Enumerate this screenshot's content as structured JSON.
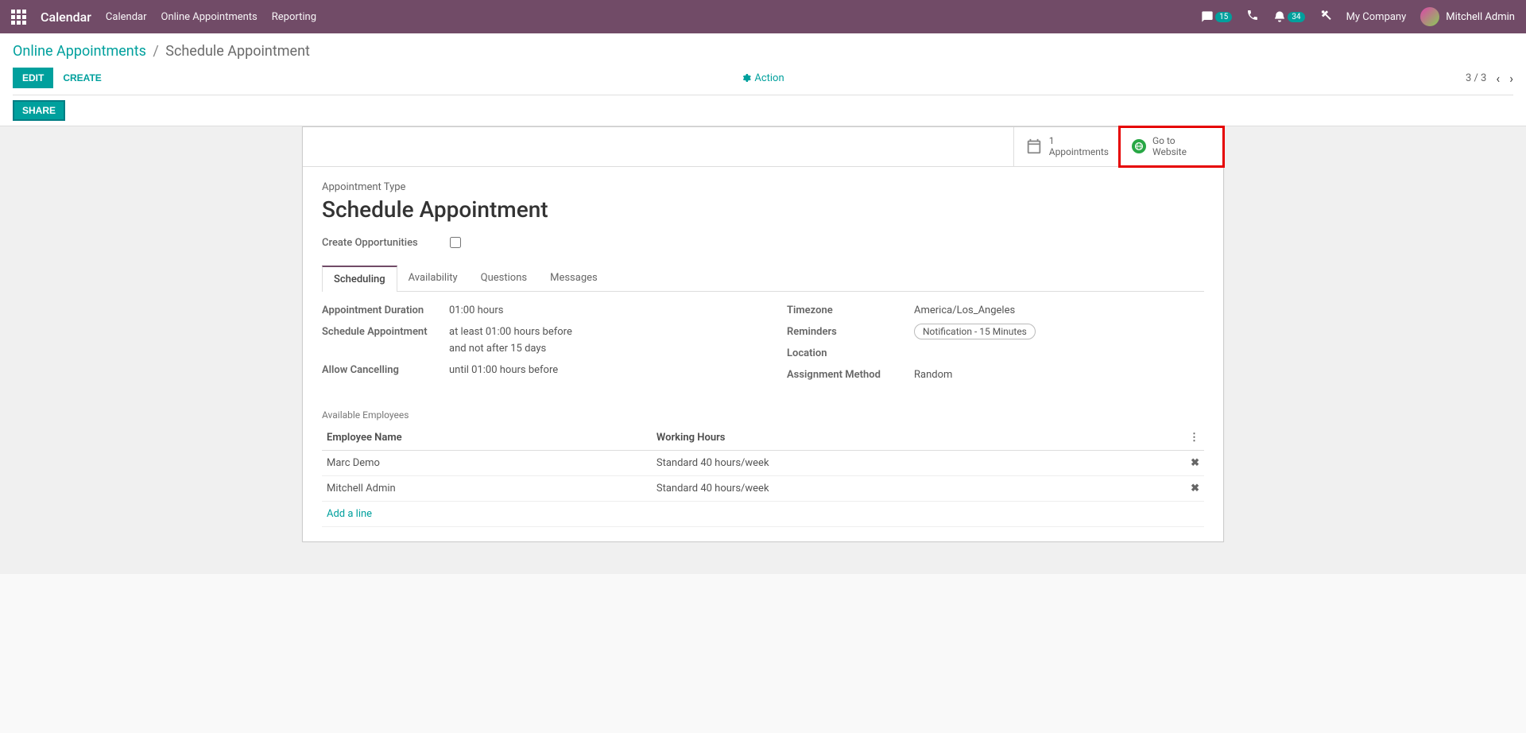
{
  "navbar": {
    "app_title": "Calendar",
    "links": [
      "Calendar",
      "Online Appointments",
      "Reporting"
    ],
    "conv_badge": "15",
    "activity_badge": "34",
    "company": "My Company",
    "user": "Mitchell Admin"
  },
  "breadcrumb": {
    "parent": "Online Appointments",
    "current": "Schedule Appointment"
  },
  "buttons": {
    "edit": "EDIT",
    "create": "CREATE",
    "action": "Action",
    "share": "SHARE"
  },
  "pager": {
    "text": "3 / 3"
  },
  "stat_buttons": {
    "appointments": {
      "count": "1",
      "label": "Appointments"
    },
    "website": {
      "line1": "Go to",
      "line2": "Website"
    }
  },
  "form": {
    "type_label": "Appointment Type",
    "title": "Schedule Appointment",
    "create_opp_label": "Create Opportunities",
    "create_opp_checked": false
  },
  "tabs": [
    "Scheduling",
    "Availability",
    "Questions",
    "Messages"
  ],
  "scheduling": {
    "duration_label": "Appointment Duration",
    "duration_value": "01:00 hours",
    "sched_label": "Schedule Appointment",
    "sched_line1": "at least 01:00 hours before",
    "sched_line2": "and not after 15 days",
    "cancel_label": "Allow Cancelling",
    "cancel_value": "until 01:00 hours before",
    "tz_label": "Timezone",
    "tz_value": "America/Los_Angeles",
    "rem_label": "Reminders",
    "rem_value": "Notification - 15 Minutes",
    "loc_label": "Location",
    "assign_label": "Assignment Method",
    "assign_value": "Random"
  },
  "employees": {
    "section": "Available Employees",
    "col_name": "Employee Name",
    "col_hours": "Working Hours",
    "rows": [
      {
        "name": "Marc Demo",
        "hours": "Standard 40 hours/week"
      },
      {
        "name": "Mitchell Admin",
        "hours": "Standard 40 hours/week"
      }
    ],
    "add_line": "Add a line"
  }
}
